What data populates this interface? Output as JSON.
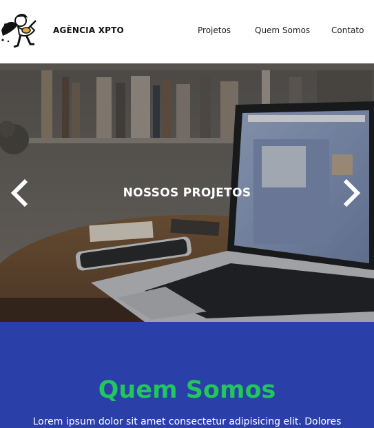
{
  "header": {
    "brand": "AGÊNCIA XPTO",
    "logo_icon": "dog-runner-illustration-icon",
    "nav": [
      {
        "label": "Projetos"
      },
      {
        "label": "Quem Somos"
      },
      {
        "label": "Contato"
      }
    ]
  },
  "hero": {
    "title": "NOSSOS PROJETOS",
    "prev_icon": "chevron-left-icon",
    "next_icon": "chevron-right-icon"
  },
  "about": {
    "title": "Quem Somos",
    "text": "Lorem ipsum dolor sit amet consectetur adipisicing elit. Dolores"
  },
  "colors": {
    "about_bg": "#2a3fa8",
    "about_title": "#22c55e",
    "hero_text": "#ffffff"
  }
}
